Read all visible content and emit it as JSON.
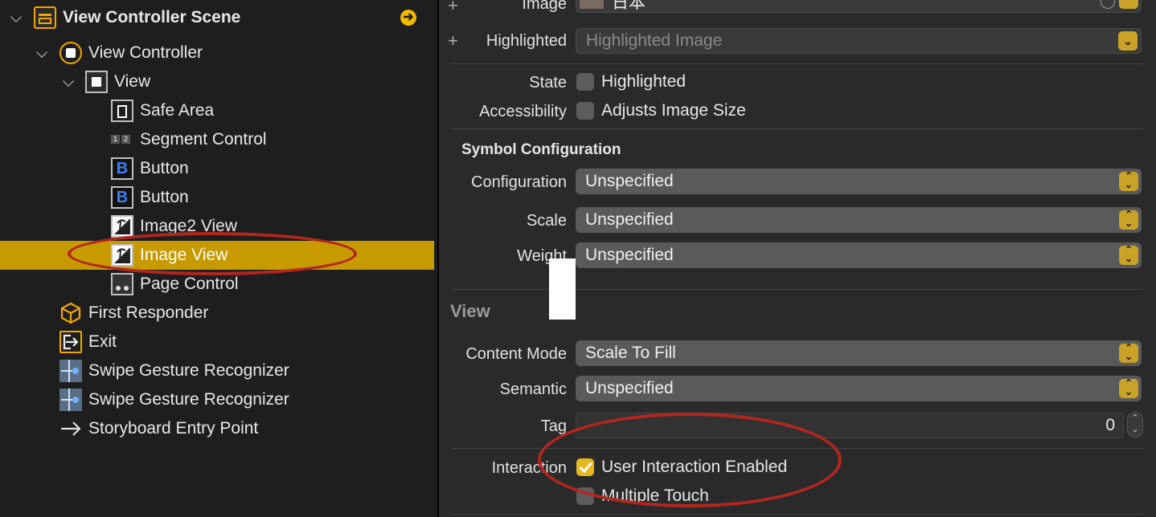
{
  "outline": {
    "items": [
      {
        "label": "View Controller Scene",
        "icon": "scene-icon"
      },
      {
        "label": "View Controller",
        "icon": "view-controller-icon"
      },
      {
        "label": "View",
        "icon": "view-icon"
      },
      {
        "label": "Safe Area",
        "icon": "safe-area-icon"
      },
      {
        "label": "Segment Control",
        "icon": "segmented-control-icon"
      },
      {
        "label": "Button",
        "icon": "button-icon"
      },
      {
        "label": "Button",
        "icon": "button-icon"
      },
      {
        "label": "Image2 View",
        "icon": "image-view-icon"
      },
      {
        "label": "Image View",
        "icon": "image-view-icon",
        "selected": true
      },
      {
        "label": "Page Control",
        "icon": "page-control-icon"
      },
      {
        "label": "First Responder",
        "icon": "first-responder-icon"
      },
      {
        "label": "Exit",
        "icon": "exit-icon"
      },
      {
        "label": "Swipe Gesture Recognizer",
        "icon": "swipe-gesture-icon"
      },
      {
        "label": "Swipe Gesture Recognizer",
        "icon": "swipe-gesture-icon"
      },
      {
        "label": "Storyboard Entry Point",
        "icon": "entry-arrow-icon"
      }
    ],
    "segment_glyphs": [
      "1",
      "2"
    ],
    "button_glyph": "B"
  },
  "inspector": {
    "image": {
      "label": "Image",
      "value": "日本"
    },
    "highlighted": {
      "label": "Highlighted",
      "placeholder": "Highlighted Image"
    },
    "state": {
      "label": "State",
      "option": "Highlighted",
      "checked": false
    },
    "accessibility": {
      "label": "Accessibility",
      "option": "Adjusts Image Size",
      "checked": false
    },
    "symbol_section": "Symbol Configuration",
    "configuration": {
      "label": "Configuration",
      "value": "Unspecified"
    },
    "scale": {
      "label": "Scale",
      "value": "Unspecified"
    },
    "weight": {
      "label": "Weight",
      "value": "Unspecified"
    },
    "view_section": "View",
    "content_mode": {
      "label": "Content Mode",
      "value": "Scale To Fill"
    },
    "semantic": {
      "label": "Semantic",
      "value": "Unspecified"
    },
    "tag": {
      "label": "Tag",
      "value": "0"
    },
    "interaction": {
      "label": "Interaction",
      "option": "User Interaction Enabled",
      "checked": true
    },
    "multiple_touch": {
      "option": "Multiple Touch",
      "checked": false
    }
  },
  "colors": {
    "selection": "#c79a00",
    "accent": "#e6b81f",
    "annotation": "#b3261e"
  }
}
